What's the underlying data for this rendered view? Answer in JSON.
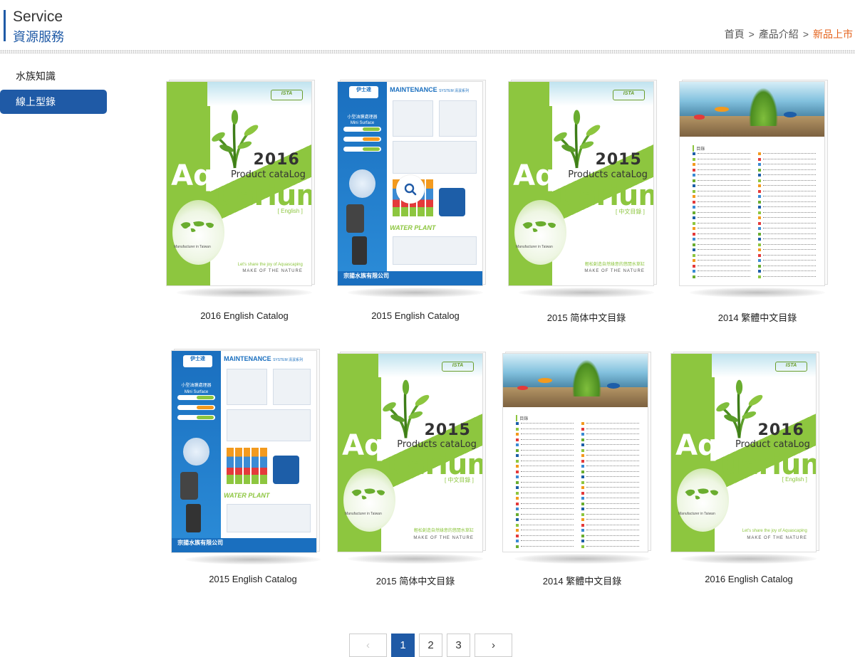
{
  "header": {
    "title_en": "Service",
    "title_zh": "資源服務",
    "breadcrumb": [
      {
        "label": "首頁",
        "active": false
      },
      {
        "label": "產品介紹",
        "active": false
      },
      {
        "label": "新品上市",
        "active": true
      }
    ],
    "breadcrumb_sep": ">"
  },
  "sidebar": {
    "items": [
      {
        "label": "水族知識",
        "active": false
      },
      {
        "label": "線上型錄",
        "active": true
      }
    ]
  },
  "catalogs": [
    {
      "title": "2016 English Catalog",
      "cover": "aquarium",
      "year": "2016",
      "subtitle": "Product cataLog",
      "lang_tag": "[ English ]",
      "slogan": "Let's share the joy of Aquascaping"
    },
    {
      "title": "2015 English Catalog",
      "cover": "maintenance",
      "hover": true
    },
    {
      "title": "2015 简体中文目錄",
      "cover": "aquarium",
      "year": "2015",
      "subtitle": "Products cataLog",
      "lang_tag": "[ 中文目錄 ]",
      "slogan": "輕松創造自然綠意的悠閒水草缸"
    },
    {
      "title": "2014 繁體中文目錄",
      "cover": "toc"
    },
    {
      "title": "2015 English Catalog",
      "cover": "maintenance"
    },
    {
      "title": "2015 简体中文目錄",
      "cover": "aquarium",
      "year": "2015",
      "subtitle": "Products cataLog",
      "lang_tag": "[ 中文目錄 ]",
      "slogan": "輕松創造自然綠意的悠閒水草缸"
    },
    {
      "title": "2014 繁體中文目錄",
      "cover": "toc"
    },
    {
      "title": "2016 English Catalog",
      "cover": "aquarium",
      "year": "2016",
      "subtitle": "Product cataLog",
      "lang_tag": "[ English ]",
      "slogan": "Let's share the joy of Aquascaping"
    }
  ],
  "cover_text": {
    "aquarium_aq": "Aq",
    "aquarium_rest": "uarium",
    "manufacturer": "Manufacturer in Taiwan",
    "make_nature": "MAKE OF THE NATURE",
    "logo": "ISTA",
    "maintenance_title": "MAINTENANCE",
    "maintenance_system": "SYSTEM 清潔系列",
    "maintenance_skimmer": "小型油膜處理器 Mini Surface Skimmer",
    "maintenance_water_plant": "WATER PLANT",
    "maintenance_company": "宗揚水族有限公司",
    "maintenance_logo": "伊士達",
    "toc_heading": "目錄"
  },
  "pagination": {
    "prev": "‹",
    "next": "›",
    "pages": [
      "1",
      "2",
      "3"
    ],
    "current": "1"
  },
  "colors": {
    "brand_blue": "#1f5aa6",
    "breadcrumb_active": "#e4621b",
    "catalog_green": "#8dc63f"
  }
}
